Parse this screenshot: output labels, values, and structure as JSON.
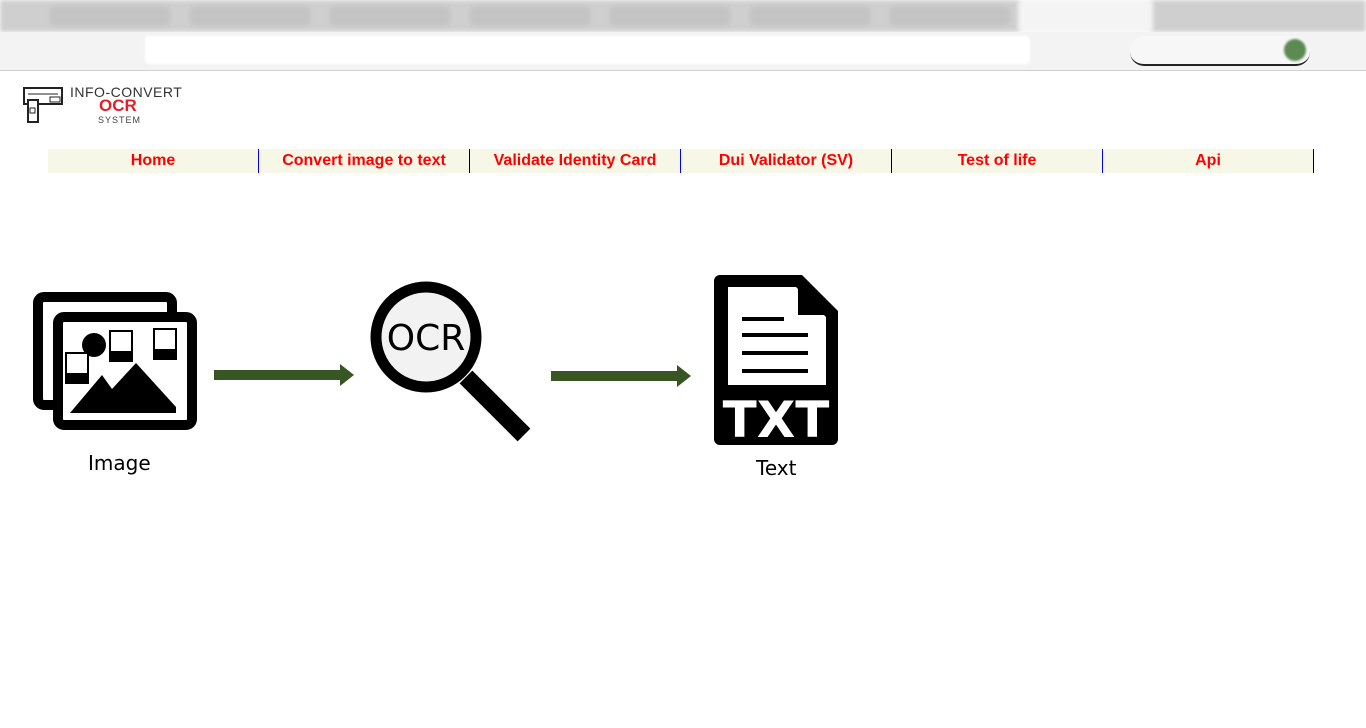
{
  "logo": {
    "line1": "INFO-CONVERT",
    "line2": "OCR",
    "line3": "SYSTEM"
  },
  "nav": [
    {
      "label": "Home"
    },
    {
      "label": "Convert image to text"
    },
    {
      "label": "Validate Identity Card"
    },
    {
      "label": "Dui Validator (SV)"
    },
    {
      "label": "Test of life"
    },
    {
      "label": "Api"
    }
  ],
  "diagram": {
    "image_caption": "Image",
    "ocr_label": "OCR",
    "txt_badge": "TXT",
    "text_caption": "Text",
    "arrow_color": "#375623"
  }
}
